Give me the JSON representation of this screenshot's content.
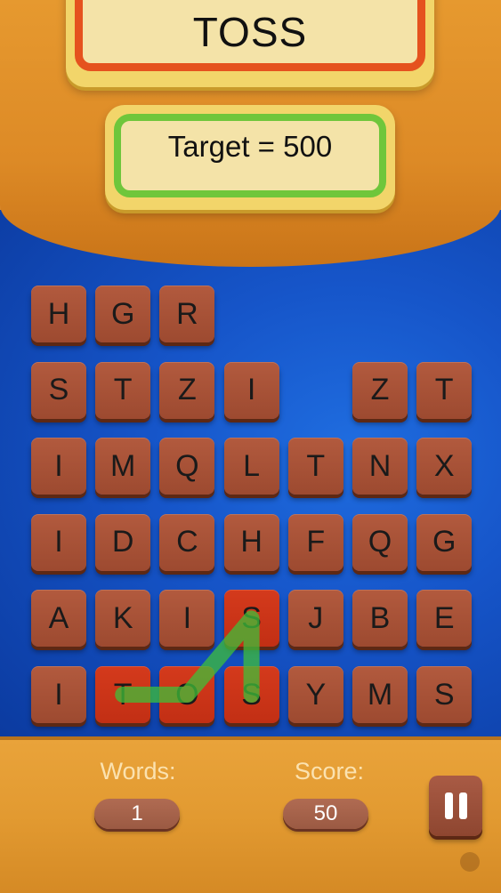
{
  "header": {
    "current_word": "TOSS",
    "target_text": "Target = 500"
  },
  "board": {
    "rows": [
      [
        "H",
        "G",
        "R",
        "",
        "",
        "",
        ""
      ],
      [
        "S",
        "T",
        "Z",
        "I",
        "",
        "Z",
        "T"
      ],
      [
        "I",
        "M",
        "Q",
        "L",
        "T",
        "N",
        "X"
      ],
      [
        "I",
        "D",
        "C",
        "H",
        "F",
        "Q",
        "G"
      ],
      [
        "A",
        "K",
        "I",
        "S",
        "J",
        "B",
        "E"
      ],
      [
        "I",
        "T",
        "O",
        "S",
        "Y",
        "M",
        "S"
      ]
    ],
    "selected_path": [
      [
        5,
        1
      ],
      [
        5,
        2
      ],
      [
        4,
        3
      ],
      [
        5,
        3
      ]
    ],
    "colors": {
      "tile": "#9d4a30",
      "tile_selected": "#c22f14",
      "trail": "#3fbf3a",
      "board_blue": "#1655c9"
    }
  },
  "footer": {
    "words_label": "Words:",
    "words_value": "1",
    "score_label": "Score:",
    "score_value": "50",
    "pause_icon": "pause-icon"
  }
}
